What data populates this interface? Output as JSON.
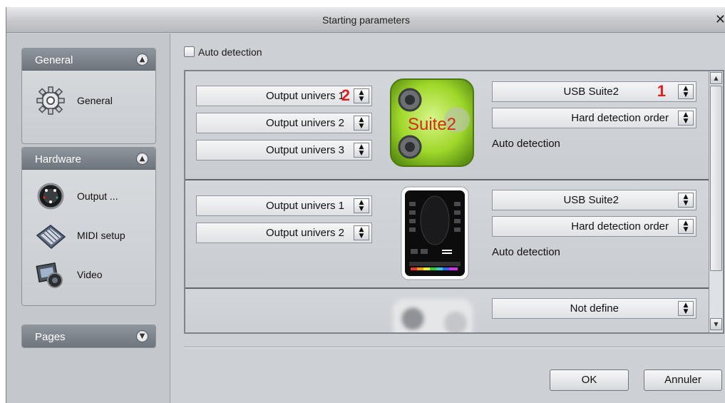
{
  "window": {
    "title": "Starting parameters",
    "close_glyph": "✕"
  },
  "sidebar": {
    "panels": [
      {
        "title": "General",
        "state": "expanded",
        "chevron": "chevron-up-icon",
        "items": [
          {
            "label": "General",
            "icon": "gear-icon"
          }
        ]
      },
      {
        "title": "Hardware",
        "state": "expanded",
        "chevron": "chevron-up-icon",
        "items": [
          {
            "label": "Output ...",
            "icon": "output-knob-icon"
          },
          {
            "label": "MIDI setup",
            "icon": "midi-keyboard-icon"
          },
          {
            "label": "Video",
            "icon": "video-camera-icon"
          }
        ]
      },
      {
        "title": "Pages",
        "state": "collapsed",
        "chevron": "chevron-down-icon",
        "items": []
      }
    ]
  },
  "auto_detection": {
    "label": "Auto detection",
    "checked": false
  },
  "devices": [
    {
      "image": "suite2-interface-image",
      "image_label": "Suite2",
      "outputs": [
        {
          "value": "Output univers 1",
          "badge": "2"
        },
        {
          "value": "Output univers 2"
        },
        {
          "value": "Output univers 3"
        }
      ],
      "device_select": {
        "value": "USB Suite2",
        "badge": "1"
      },
      "order_select": {
        "value": "Hard detection order"
      },
      "status": "Auto detection"
    },
    {
      "image": "touch-controller-image",
      "outputs": [
        {
          "value": "Output univers 1"
        },
        {
          "value": "Output univers 2"
        }
      ],
      "device_select": {
        "value": "USB Suite2"
      },
      "order_select": {
        "value": "Hard detection order"
      },
      "status": "Auto detection"
    },
    {
      "image": "blurred-device-image",
      "outputs": [],
      "device_select": {
        "value": "Not define"
      }
    }
  ],
  "buttons": {
    "ok": "OK",
    "cancel": "Annuler"
  },
  "colors": {
    "badge": "#e02020",
    "panel_header": "#7f858c",
    "window_bg": "#cdd1d6"
  }
}
